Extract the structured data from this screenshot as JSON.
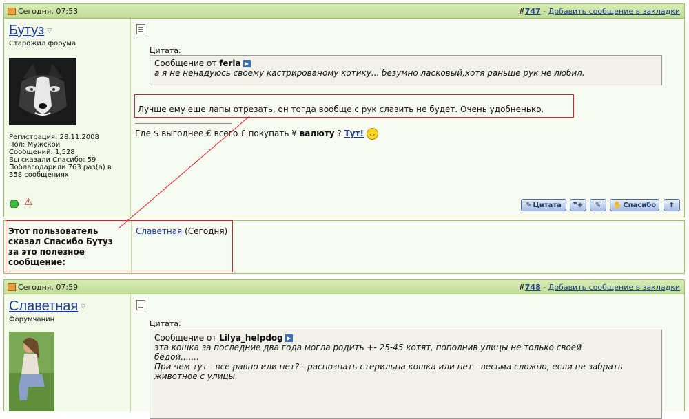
{
  "post1": {
    "date": "Сегодня, 07:53",
    "number_prefix": "#",
    "number": "747",
    "sep": " - ",
    "bookmark_link": "Добавить сообщение в закладки",
    "username": "Бутуз",
    "user_title": "Старожил форума",
    "stats": [
      "Регистрация: 28.11.2008",
      "Пол: Мужской",
      "Сообщений: 1,528",
      "Вы сказали Спасибо: 59",
      "Поблагодарили 763 раз(а) в 358 сообщениях"
    ],
    "quote_label": "Цитата:",
    "quote_from_prefix": "Сообщение от ",
    "quote_author": "feria",
    "quote_text": "а я не ненадуюсь своему кастрированому котику... безумно ласковый,хотя раньше рук не любил.",
    "message": "Лучше ему еще лапы отрезать, он тогда вообще с рук слазить не будет. Очень удобненько.",
    "signature_text": "Где $ выгоднее € всего £ покупать ¥ ",
    "signature_bold": "валюту",
    "signature_q": " ? ",
    "signature_link": "Тут!",
    "buttons": {
      "quote": "Цитата",
      "thanks": "Спасибо"
    }
  },
  "thanks_bar": {
    "label": "Этот пользователь сказал Спасибо Бутуз за это полезное сообщение:",
    "user": "Славетная",
    "when": " (Сегодня)"
  },
  "post2": {
    "date": "Сегодня, 07:59",
    "number_prefix": "#",
    "number": "748",
    "sep": " - ",
    "bookmark_link": "Добавить сообщение в закладки",
    "username": "Славетная",
    "user_title": "Форумчанин",
    "quote_label": "Цитата:",
    "quote_from_prefix": "Сообщение от ",
    "quote_author": "Lilya_helpdog",
    "quote_line1": "эта кошка за последние два года могла родить +- 25-45 котят, пополнив улицы не только своей",
    "quote_line2": "бедой.......",
    "quote_line3": "При чем тут - все равно или нет? - распознать стерильна кошка или нет - весьма сложно, если не забрать",
    "quote_line4": "животное с улицы."
  },
  "colors": {
    "header_green": "#c0dc95",
    "border_green": "#9bbf6a",
    "link_blue": "#1b3a94",
    "annotation_red": "#e02020"
  },
  "icons": [
    "post-icon",
    "document-icon",
    "quote-arrow-icon",
    "dropdown-arrow-icon",
    "online-status-icon",
    "report-icon",
    "smile-icon",
    "multiquote-icon",
    "edit-icon",
    "thanks-icon",
    "top-icon"
  ]
}
